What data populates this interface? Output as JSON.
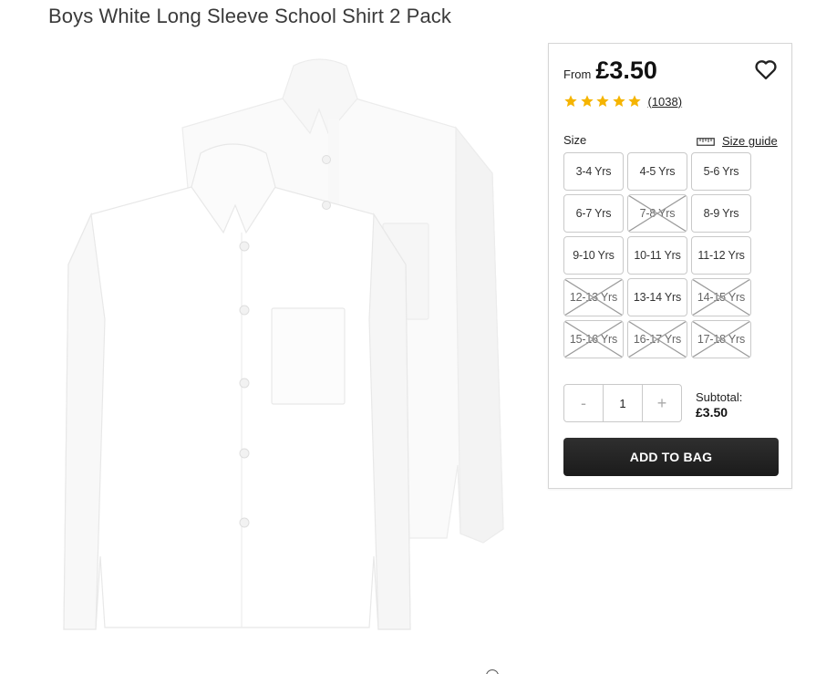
{
  "product": {
    "title": "Boys White Long Sleeve School Shirt 2 Pack"
  },
  "pricing": {
    "from_label": "From",
    "price": "£3.50"
  },
  "rating": {
    "stars": 5,
    "review_count": "(1038)",
    "star_color": "#f5b400"
  },
  "sizes": {
    "label": "Size",
    "guide_label": "Size guide",
    "options": [
      {
        "label": "3-4 Yrs",
        "available": true
      },
      {
        "label": "4-5 Yrs",
        "available": true
      },
      {
        "label": "5-6 Yrs",
        "available": true
      },
      {
        "label": "6-7 Yrs",
        "available": true
      },
      {
        "label": "7-8 Yrs",
        "available": false
      },
      {
        "label": "8-9 Yrs",
        "available": true
      },
      {
        "label": "9-10 Yrs",
        "available": true
      },
      {
        "label": "10-11 Yrs",
        "available": true
      },
      {
        "label": "11-12 Yrs",
        "available": true
      },
      {
        "label": "12-13 Yrs",
        "available": false
      },
      {
        "label": "13-14 Yrs",
        "available": true
      },
      {
        "label": "14-15 Yrs",
        "available": false
      },
      {
        "label": "15-16 Yrs",
        "available": false
      },
      {
        "label": "16-17 Yrs",
        "available": false
      },
      {
        "label": "17-18 Yrs",
        "available": false
      }
    ]
  },
  "quantity": {
    "minus": "-",
    "plus": "+",
    "value": "1"
  },
  "subtotal": {
    "label": "Subtotal:",
    "value": "£3.50"
  },
  "cart": {
    "add_label": "ADD TO BAG",
    "button_color": "#1f1f1f"
  },
  "icons": {
    "wishlist": "heart-icon",
    "size_guide": "ruler-icon",
    "rating": "star-icon",
    "unavailable": "cross-icon"
  }
}
